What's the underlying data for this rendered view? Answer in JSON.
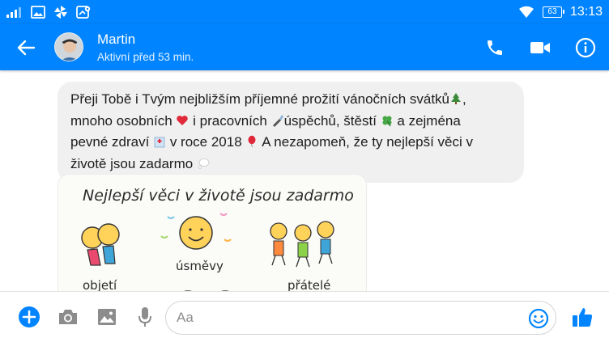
{
  "status_bar": {
    "battery": "63",
    "clock": "13:13"
  },
  "header": {
    "contact_name": "Martin",
    "contact_status": "Aktivní před 53 min."
  },
  "message": {
    "lines": [
      "Přeji Tobě i Tvým nejbližším příjemné prožití vánočních svátků",
      "mnoho osobních",
      "i pracovních",
      "úspěchů, štěstí",
      "a zejména",
      "pevné zdraví",
      "v roce 2018",
      "A nezapomeň, že ty nejlepší věci v",
      "životě jsou zadarmo"
    ]
  },
  "image_message": {
    "title": "Nejlepší věci v životě jsou zadarmo",
    "caption_hug": "objetí",
    "caption_smiles": "úsměvy",
    "caption_friends": "přátelé"
  },
  "composer": {
    "placeholder": "Aa"
  },
  "colors": {
    "brand": "#0084ff",
    "bubble": "#f1f0f0"
  }
}
